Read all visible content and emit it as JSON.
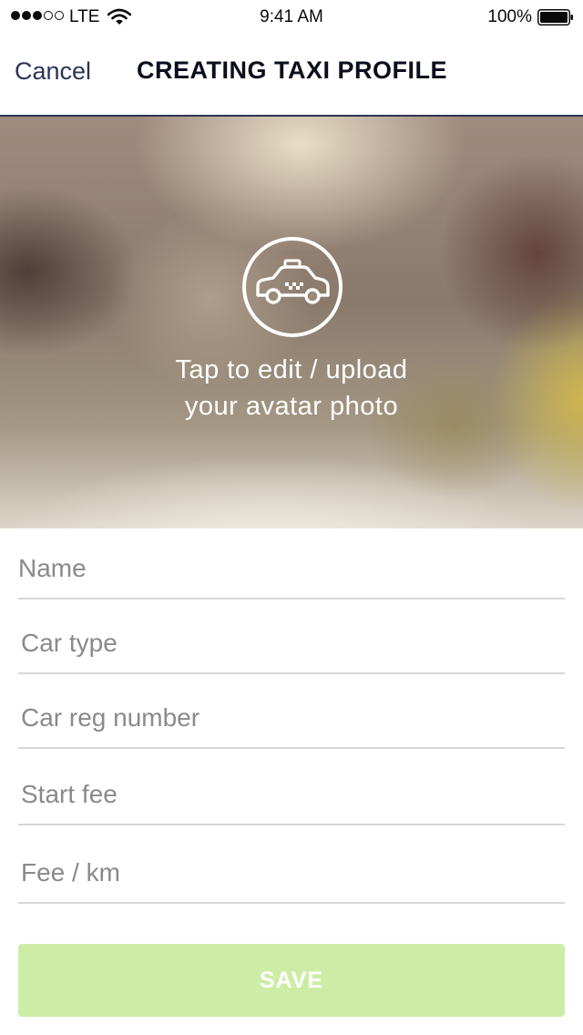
{
  "status_bar": {
    "carrier": "LTE",
    "time": "9:41 AM",
    "battery_percent": "100%",
    "icons": [
      "signal-dots-icon",
      "wifi-icon",
      "battery-icon"
    ]
  },
  "nav": {
    "cancel_label": "Cancel",
    "title": "CREATING TAXI PROFILE"
  },
  "hero": {
    "icon": "taxi-car-icon",
    "line1": "Tap to edit / upload",
    "line2": "your avatar photo"
  },
  "form": {
    "fields": [
      {
        "placeholder": "Name",
        "value": ""
      },
      {
        "placeholder": "Car type",
        "value": ""
      },
      {
        "placeholder": "Car reg number",
        "value": ""
      },
      {
        "placeholder": "Start fee",
        "value": ""
      },
      {
        "placeholder": "Fee / km",
        "value": ""
      }
    ],
    "save_label": "SAVE"
  },
  "colors": {
    "nav_text": "#2b3556",
    "title_text": "#0b0e1c",
    "divider": "#d7d7d7",
    "save_button_bg": "#cdeda6"
  }
}
